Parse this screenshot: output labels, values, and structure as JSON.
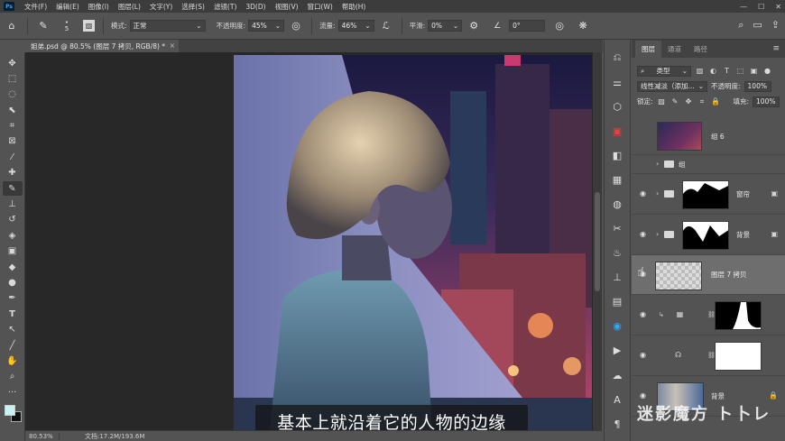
{
  "menubar": {
    "logo": "Ps",
    "items": [
      "文件(F)",
      "编辑(E)",
      "图像(I)",
      "图层(L)",
      "文字(Y)",
      "选择(S)",
      "滤镜(T)",
      "3D(D)",
      "视图(V)",
      "窗口(W)",
      "帮助(H)"
    ],
    "controls": [
      "—",
      "☐",
      "✕"
    ]
  },
  "options": {
    "mode_label": "模式:",
    "mode_value": "正常",
    "opacity_label": "不透明度:",
    "opacity_value": "45%",
    "flow_label": "流量:",
    "flow_value": "46%",
    "smooth_label": "平滑:",
    "smooth_value": "0%",
    "angle_value": "0°",
    "brush_size": "5"
  },
  "document": {
    "tab_title": "姐弟.psd @ 80.5% (图层 7 拷贝, RGB/8) *",
    "close": "×",
    "zoom": "80.53%",
    "doc_info": "文档:17.2M/193.6M"
  },
  "subtitle": "基本上就沿着它的人物的边缘",
  "layers_panel": {
    "tabs": [
      "图层",
      "通道",
      "路径"
    ],
    "menu": "≡",
    "filter_kind": "类型",
    "blend_mode": "线性减淡（添加...",
    "opacity_label": "不透明度:",
    "opacity_value": "100%",
    "lock_label": "锁定:",
    "fill_label": "填充:",
    "fill_value": "100%",
    "layers": [
      {
        "name": "组 6"
      },
      {
        "name": "组"
      },
      {
        "name": "窗帘"
      },
      {
        "name": "背景"
      },
      {
        "name": "图层 7 拷贝"
      },
      {
        "name": ""
      },
      {
        "name": ""
      },
      {
        "name": "背景"
      }
    ]
  },
  "watermark": "迷影魔方 ト卜レ",
  "colors": {
    "foreground": "#c7f3f5",
    "background": "#111111",
    "accent": "#31a8ff"
  }
}
